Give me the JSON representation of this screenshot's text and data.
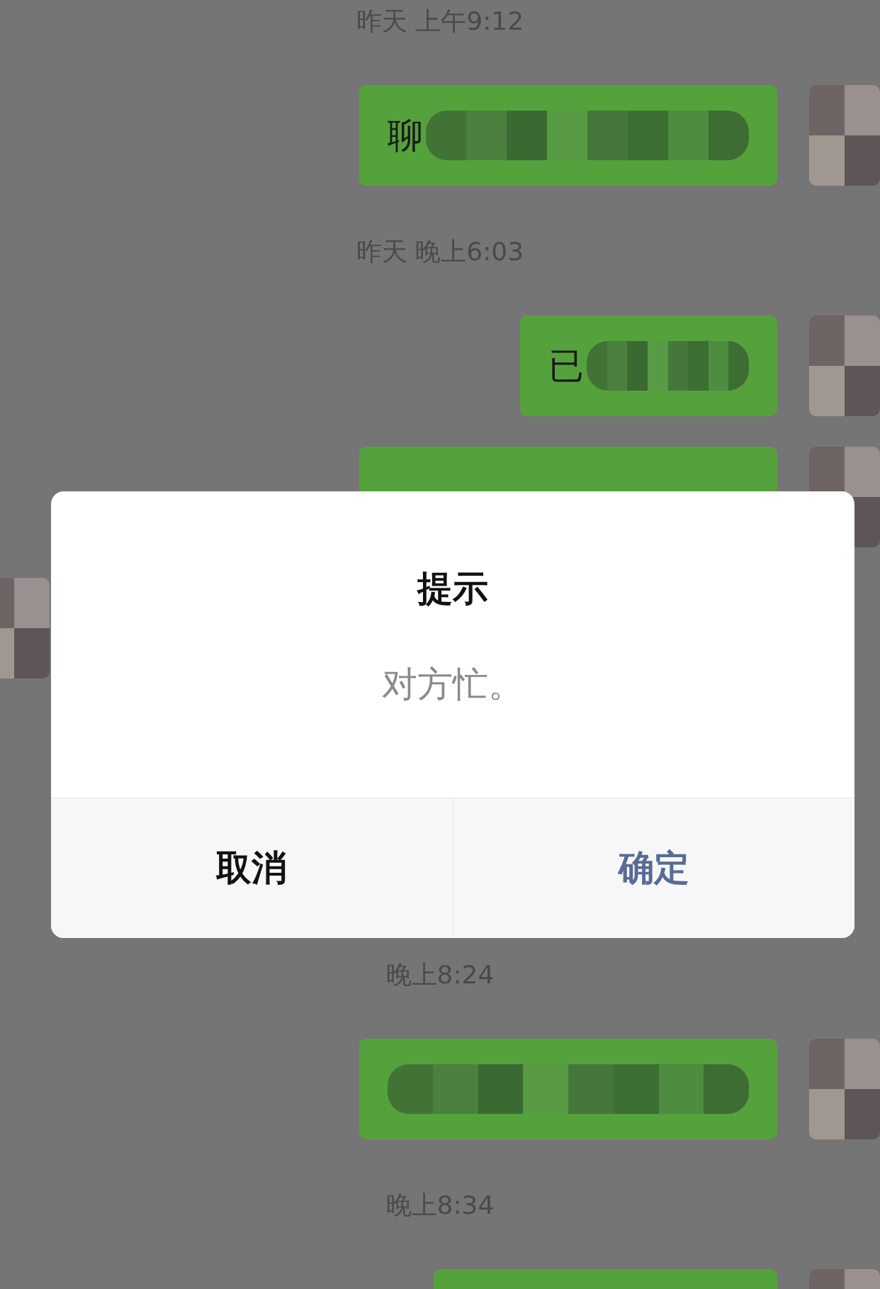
{
  "messages": [
    {
      "kind": "time",
      "text": "昨天 上午9:12"
    },
    {
      "kind": "outgoing",
      "text": "聊",
      "redacted": true
    },
    {
      "kind": "time",
      "text": "昨天 晚上6:03"
    },
    {
      "kind": "outgoing",
      "text": "已",
      "redacted": true
    },
    {
      "kind": "outgoing"
    },
    {
      "kind": "incoming"
    },
    {
      "kind": "time",
      "text": "晚上8:24"
    },
    {
      "kind": "outgoing",
      "redacted": true
    },
    {
      "kind": "time",
      "text": "晚上8:34"
    },
    {
      "kind": "outgoing"
    }
  ],
  "dialog": {
    "title": "提示",
    "message": "对方忙。",
    "buttons": [
      {
        "label": "取消",
        "kind": "cancel"
      },
      {
        "label": "确定",
        "kind": "confirm"
      }
    ]
  }
}
